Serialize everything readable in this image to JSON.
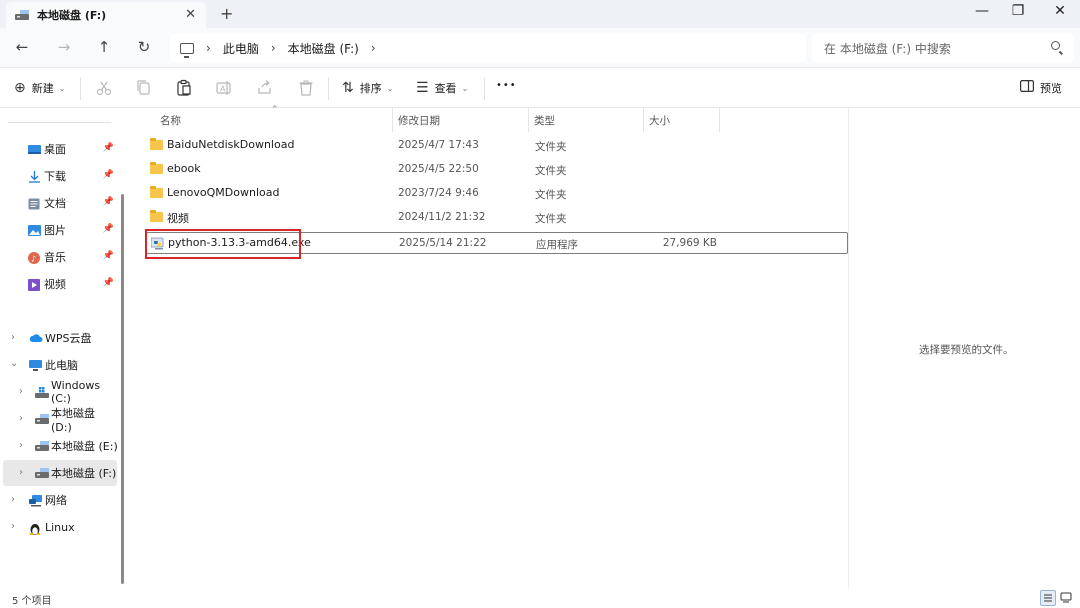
{
  "window": {
    "tab_title": "本地磁盘 (F:)",
    "new_tab": "+",
    "tab_close": "✕",
    "minimize": "—",
    "maximize": "❐",
    "close": "✕"
  },
  "nav": {
    "back": "←",
    "forward": "→",
    "up": "↑",
    "refresh": "↻"
  },
  "breadcrumb": {
    "items": [
      "此电脑",
      "本地磁盘 (F:)"
    ]
  },
  "search": {
    "placeholder": "在 本地磁盘 (F:) 中搜索"
  },
  "toolbar": {
    "new_label": "新建",
    "sort_label": "排序",
    "view_label": "查看",
    "more": "•••",
    "preview_label": "预览"
  },
  "sidebar": {
    "quick": [
      {
        "label": "桌面",
        "icon": "desktop-icon"
      },
      {
        "label": "下载",
        "icon": "download-icon"
      },
      {
        "label": "文档",
        "icon": "document-icon"
      },
      {
        "label": "图片",
        "icon": "pictures-icon"
      },
      {
        "label": "音乐",
        "icon": "music-icon"
      },
      {
        "label": "视频",
        "icon": "video-icon"
      }
    ],
    "tree": [
      {
        "label": "WPS云盘",
        "icon": "cloud-icon",
        "expanded": false
      },
      {
        "label": "此电脑",
        "icon": "this-pc-icon",
        "expanded": true
      },
      {
        "label": "Windows (C:)",
        "icon": "windows-drive-icon",
        "expanded": false
      },
      {
        "label": "本地磁盘 (D:)",
        "icon": "drive-icon",
        "expanded": false
      },
      {
        "label": "本地磁盘 (E:)",
        "icon": "drive-icon",
        "expanded": false
      },
      {
        "label": "本地磁盘 (F:)",
        "icon": "drive-icon",
        "expanded": false
      },
      {
        "label": "网络",
        "icon": "network-icon",
        "expanded": false
      },
      {
        "label": "Linux",
        "icon": "linux-icon",
        "expanded": false
      }
    ]
  },
  "columns": {
    "name": "名称",
    "date": "修改日期",
    "type": "类型",
    "size": "大小"
  },
  "files": [
    {
      "name": "BaiduNetdiskDownload",
      "date": "2025/4/7 17:43",
      "type": "文件夹",
      "size": "",
      "kind": "folder"
    },
    {
      "name": "ebook",
      "date": "2025/4/5 22:50",
      "type": "文件夹",
      "size": "",
      "kind": "folder"
    },
    {
      "name": "LenovoQMDownload",
      "date": "2023/7/24 9:46",
      "type": "文件夹",
      "size": "",
      "kind": "folder"
    },
    {
      "name": "视频",
      "date": "2024/11/2 21:32",
      "type": "文件夹",
      "size": "",
      "kind": "folder"
    },
    {
      "name": "python-3.13.3-amd64.exe",
      "date": "2025/5/14 21:22",
      "type": "应用程序",
      "size": "27,969 KB",
      "kind": "exe"
    }
  ],
  "preview": {
    "message": "选择要预览的文件。"
  },
  "status": {
    "count": "5 个项目"
  },
  "colors": {
    "highlight": "#d62828",
    "folder": "#f7c54b",
    "tabstrip": "#eef1f5"
  }
}
